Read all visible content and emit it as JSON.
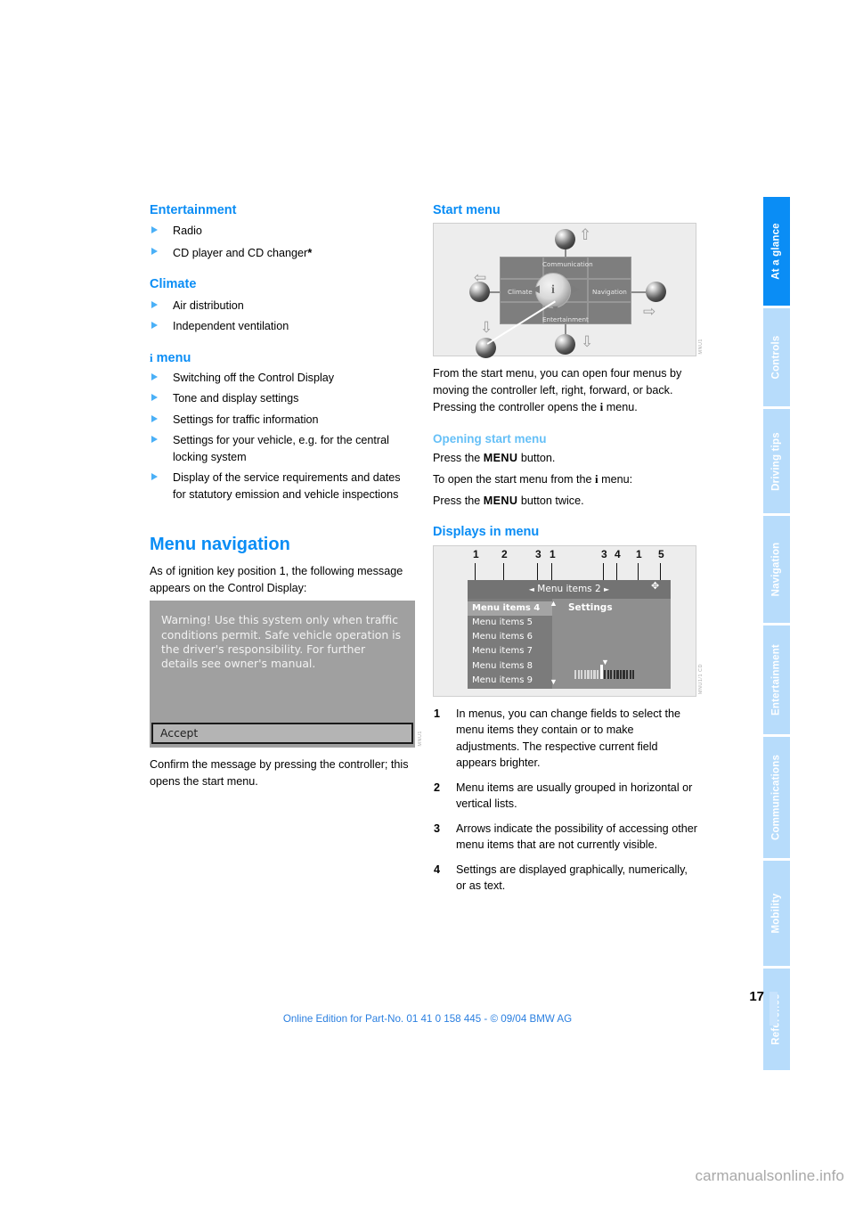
{
  "page": {
    "number": "17",
    "footer": "Online Edition for Part-No. 01 41 0 158 445 - © 09/04 BMW AG",
    "watermark": "carmanualsonline.info"
  },
  "tabs": [
    {
      "label": "At a glance",
      "active": true
    },
    {
      "label": "Controls",
      "active": false
    },
    {
      "label": "Driving tips",
      "active": false
    },
    {
      "label": "Navigation",
      "active": false
    },
    {
      "label": "Entertainment",
      "active": false
    },
    {
      "label": "Communications",
      "active": false
    },
    {
      "label": "Mobility",
      "active": false
    },
    {
      "label": "Reference",
      "active": false
    }
  ],
  "left_column": {
    "entertainment": {
      "heading": "Entertainment",
      "items": [
        "Radio",
        "CD player and CD changer"
      ],
      "item2_suffix": "*"
    },
    "climate": {
      "heading": "Climate",
      "items": [
        "Air distribution",
        "Independent ventilation"
      ]
    },
    "i_menu": {
      "icon": "i-glyph",
      "heading": "menu",
      "items": [
        "Switching off the Control Display",
        "Tone and display settings",
        "Settings for traffic information",
        "Settings for your vehicle, e.g. for the central locking system",
        "Display of the service requirements and dates for statutory emission and vehicle inspections"
      ]
    },
    "menu_navigation": {
      "heading": "Menu navigation",
      "intro": "As of ignition key position 1, the following message appears on the Control Display:",
      "figure": {
        "name": "control-display-warning",
        "warning_text": "Warning! Use this system only when traffic conditions permit. Safe vehicle operation is the driver's responsibility. For further details see owner's manual.",
        "accept_label": "Accept",
        "code": "MNU1"
      },
      "after": "Confirm the message by pressing the controller; this opens the start menu."
    }
  },
  "right_column": {
    "start_menu": {
      "heading": "Start menu",
      "figure": {
        "name": "start-menu-diagram",
        "code": "MNU1",
        "center_icon": "i",
        "labels": {
          "top": "Communication",
          "left": "Climate",
          "right": "Navigation",
          "bottom": "Entertainment"
        }
      },
      "paragraph_1_a": "From the start menu, you can open four menus by moving the controller left, right, forward, or back. Pressing the controller opens the ",
      "paragraph_1_i": "i",
      "paragraph_1_b": " menu.",
      "opening": {
        "heading": "Opening start menu",
        "line1_a": "Press the ",
        "line1_kw": "MENU",
        "line1_b": " button.",
        "line2_a": "To open the start menu from the ",
        "line2_i": "i",
        "line2_b": " menu:",
        "line3_a": "Press the ",
        "line3_kw": "MENU",
        "line3_b": " button twice."
      }
    },
    "displays_in_menu": {
      "heading": "Displays in menu",
      "figure": {
        "name": "displays-in-menu-diagram",
        "code": "MNU1/1 CD",
        "callout_numbers": [
          "1",
          "2",
          "3",
          "1",
          "3",
          "4",
          "1",
          "5"
        ],
        "header_text": "Menu items 2",
        "settings_label": "Settings",
        "list_items": [
          "Menu items 4",
          "Menu items 5",
          "Menu items 6",
          "Menu items 7",
          "Menu items 8",
          "Menu items 9"
        ],
        "selected_index": 0
      },
      "notes": [
        {
          "num": "1",
          "text": "In menus, you can change fields to select the menu items they contain or to make adjustments. The respective current field appears brighter."
        },
        {
          "num": "2",
          "text": "Menu items are usually grouped in horizontal or vertical lists."
        },
        {
          "num": "3",
          "text": "Arrows indicate the possibility of accessing other menu items that are not currently visible."
        },
        {
          "num": "4",
          "text": "Settings are displayed graphically, numerically, or as text."
        }
      ]
    }
  },
  "colors": {
    "accent": "#0a8df5",
    "subaccent": "#66c0f7",
    "tab_inactive": "#b7dcfb",
    "footer_link": "#2a7fe0"
  }
}
